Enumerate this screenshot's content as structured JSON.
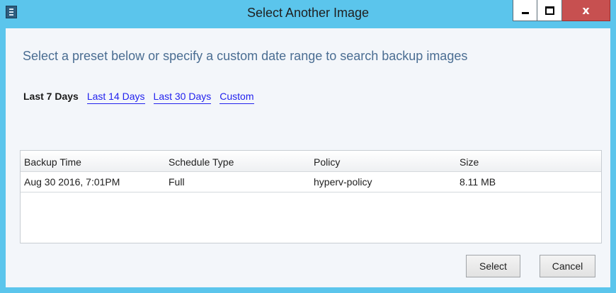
{
  "window": {
    "title": "Select Another Image",
    "close_glyph": "x"
  },
  "instruction": "Select a preset below or specify a custom date range to search backup images",
  "presets": [
    {
      "label": "Last 7 Days",
      "active": true
    },
    {
      "label": "Last 14 Days",
      "active": false
    },
    {
      "label": "Last 30 Days",
      "active": false
    },
    {
      "label": "Custom",
      "active": false
    }
  ],
  "table": {
    "columns": [
      "Backup Time",
      "Schedule Type",
      "Policy",
      "Size"
    ],
    "rows": [
      [
        "Aug 30 2016, 7:01PM",
        "Full",
        "hyperv-policy",
        "8.11 MB"
      ]
    ]
  },
  "buttons": {
    "select": "Select",
    "cancel": "Cancel"
  },
  "colors": {
    "frame": "#5bc5ec",
    "link": "#2222ee",
    "instruction": "#4a6d92",
    "close_button": "#c75050"
  }
}
